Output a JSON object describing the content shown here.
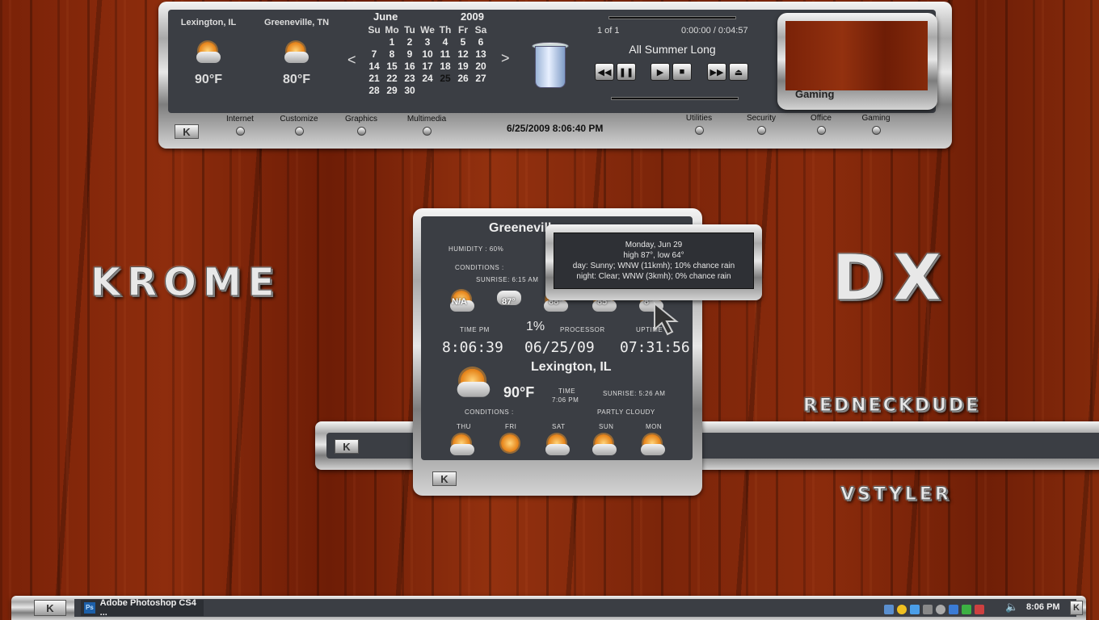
{
  "top_bar": {
    "weather": [
      {
        "city": "Lexington, IL",
        "temp": "90°F"
      },
      {
        "city": "Greeneville, TN",
        "temp": "80°F"
      }
    ],
    "calendar": {
      "month": "June",
      "year": "2009",
      "prev": "<",
      "next": ">",
      "days": [
        "Su",
        "Mo",
        "Tu",
        "We",
        "Th",
        "Fr",
        "Sa"
      ],
      "rows": [
        [
          "",
          "",
          "1",
          "2",
          "3",
          "4",
          "5",
          "6"
        ],
        [
          "7",
          "8",
          "9",
          "10",
          "11",
          "12",
          "13"
        ],
        [
          "14",
          "15",
          "16",
          "17",
          "18",
          "19",
          "20"
        ],
        [
          "21",
          "22",
          "23",
          "24",
          "25",
          "26",
          "27"
        ],
        [
          "28",
          "29",
          "30",
          "",
          "",
          "",
          ""
        ]
      ],
      "today": "25"
    },
    "player": {
      "track_count": "1 of 1",
      "time": "0:00:00 / 0:04:57",
      "title": "All Summer Long"
    },
    "gaming_label": "Gaming",
    "menu_left": [
      "Internet",
      "Customize",
      "Graphics",
      "Multimedia"
    ],
    "datetime": "6/25/2009 8:06:40 PM",
    "menu_right": [
      "Utilities",
      "Security",
      "Office",
      "Gaming"
    ],
    "k_label": "K"
  },
  "branding": {
    "krome": "KROME",
    "dx": "DX",
    "redneck": "REDNECKDUDE",
    "vstyler": "VSTYLER"
  },
  "widget": {
    "city_top": "Greenevill",
    "humidity": "HUMIDITY : 60%",
    "conditions": "CONDITIONS :",
    "sunrise_top": "SUNRISE: 6:15 AM",
    "forecast_temps": [
      "N/A",
      "87°",
      "88°",
      "85°",
      "8°"
    ],
    "time_label": "TIME PM",
    "cpu_pct": "1%",
    "cpu_label": "PROCESSOR",
    "uptime_label": "UPTIME",
    "time_value": "8:06:39",
    "date_value": "06/25/09",
    "uptime_value": "07:31:56",
    "city_bottom": "Lexington, IL",
    "temp": "90°F",
    "time_small_label": "TIME",
    "time_small": "7:06 PM",
    "sunrise_bottom": "SUNRISE: 5:26 AM",
    "conditions_bottom": "CONDITIONS :",
    "condition_value": "PARTLY CLOUDY",
    "days": [
      "THU",
      "FRI",
      "SAT",
      "SUN",
      "MON"
    ]
  },
  "tooltip": {
    "line1": "Monday, Jun 29",
    "line2": "high 87°, low 64°",
    "line3": "day: Sunny; WNW (11kmh); 10% chance rain",
    "line4": "night: Clear; WNW (3kmh); 0% chance rain"
  },
  "taskbar": {
    "start": "K",
    "app": "Adobe Photoshop CS4 ...",
    "app_icon": "Ps",
    "clock": "8:06 PM"
  }
}
